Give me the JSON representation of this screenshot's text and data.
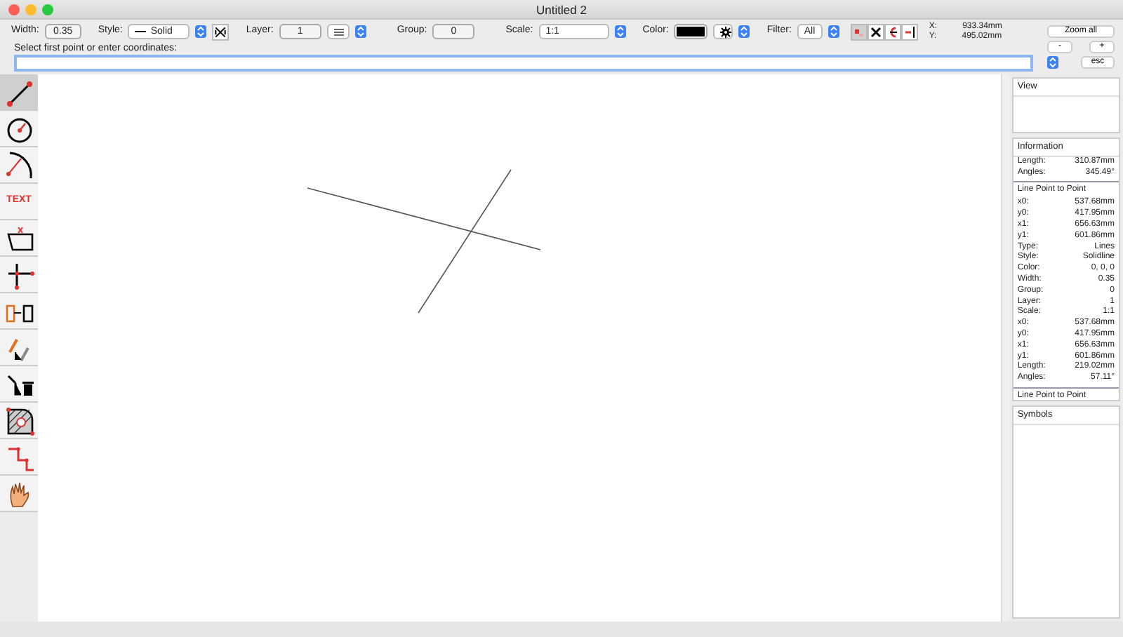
{
  "window": {
    "title": "Untitled 2"
  },
  "toolbar": {
    "width": {
      "label": "Width:",
      "value": "0.35"
    },
    "style": {
      "label": "Style:",
      "value": "Solid"
    },
    "layer": {
      "label": "Layer:",
      "value": "1"
    },
    "group": {
      "label": "Group:",
      "value": "0"
    },
    "scale": {
      "label": "Scale:",
      "value": "1:1"
    },
    "color": {
      "label": "Color:",
      "color": "#000000"
    },
    "filter": {
      "label": "Filter:",
      "value": "All"
    },
    "filter_buttons": [
      {
        "selected": true
      },
      {
        "selected": false
      },
      {
        "selected": false
      },
      {
        "selected": false
      }
    ],
    "coords": [
      {
        "label": "X:",
        "value": "933.34mm"
      },
      {
        "label": "Y:",
        "value": "495.02mm"
      }
    ],
    "zoom_all": "Zoom all",
    "zoom_out": "-",
    "zoom_in": "+",
    "esc": "esc"
  },
  "prompt": {
    "label": "Select first point or enter coordinates:"
  },
  "tools": [
    {
      "selected": true
    },
    {
      "selected": false
    },
    {
      "selected": false
    },
    {
      "selected": false,
      "label": "TEXT"
    },
    {
      "selected": false
    },
    {
      "selected": false
    },
    {
      "selected": false
    },
    {
      "selected": false
    },
    {
      "selected": false
    },
    {
      "selected": false
    },
    {
      "selected": false
    },
    {
      "selected": false
    }
  ],
  "panels": {
    "view": {
      "title": "View"
    },
    "information": {
      "title": "Information",
      "sections": [
        {
          "rows": [
            {
              "label": "Length:",
              "value": "310.87mm"
            },
            {
              "label": "Angles:",
              "value": "345.49°"
            }
          ]
        },
        {
          "title": "Line Point to Point",
          "rows": [
            {
              "label": "x0:",
              "value": "537.68mm"
            },
            {
              "label": "y0:",
              "value": "417.95mm"
            },
            {
              "label": "x1:",
              "value": "656.63mm"
            },
            {
              "label": "y1:",
              "value": "601.86mm"
            },
            {
              "label": "Type:",
              "value": "Lines"
            },
            {
              "label": "Style:",
              "value": "Solidline"
            },
            {
              "label": "Color:",
              "value": "0, 0, 0"
            },
            {
              "label": "Width:",
              "value": "0.35"
            },
            {
              "label": "Group:",
              "value": "0"
            },
            {
              "label": "Layer:",
              "value": "1"
            },
            {
              "label": "Scale:",
              "value": "1:1"
            },
            {
              "label": "x0:",
              "value": "537.68mm"
            },
            {
              "label": "y0:",
              "value": "417.95mm"
            },
            {
              "label": "x1:",
              "value": "656.63mm"
            },
            {
              "label": "y1:",
              "value": "601.86mm"
            },
            {
              "label": "Length:",
              "value": "219.02mm"
            },
            {
              "label": "Angles:",
              "value": "57.11°"
            }
          ]
        },
        {
          "title": "Line Point to Point"
        }
      ]
    },
    "symbols": {
      "title": "Symbols"
    }
  }
}
